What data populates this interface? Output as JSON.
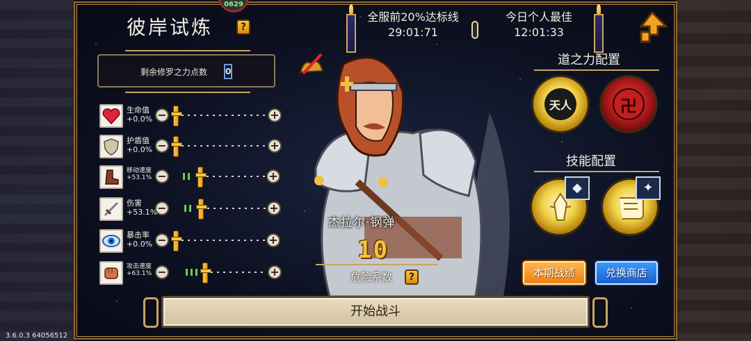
{
  "title": "彼岸试炼",
  "help_icon": "?",
  "top_gauge_label": "0629",
  "rank_threshold": {
    "label": "全服前20%达标线",
    "time": "29:01:71"
  },
  "personal_best": {
    "label": "今日个人最佳",
    "time": "12:01:33"
  },
  "points": {
    "label": "剩余修罗之力点数",
    "value": "0"
  },
  "stats": [
    {
      "name": "生命值",
      "value": "+0.0%",
      "icon": "heart-icon"
    },
    {
      "name": "护盾值",
      "value": "+0.0%",
      "icon": "shield-icon"
    },
    {
      "name": "移动速度",
      "value": "+53.1%",
      "icon": "boot-icon"
    },
    {
      "name": "伤害",
      "value": "+53.1%",
      "icon": "sword-icon"
    },
    {
      "name": "暴击率",
      "value": "+0.0%",
      "icon": "eye-icon"
    },
    {
      "name": "攻击速度",
      "value": "+63.1%",
      "icon": "fist-icon"
    }
  ],
  "hero": {
    "name": "杰拉尔·钢弹",
    "danger_level": "10",
    "danger_label": "危险系数"
  },
  "dao_section_title": "道之力配置",
  "dao_orbs": [
    {
      "glyph": "天人",
      "style": "gold"
    },
    {
      "glyph": "卍",
      "style": "red"
    }
  ],
  "skill_section_title": "技能配置",
  "skills": [
    {
      "icon": "rune-totem-icon",
      "badge": "◆"
    },
    {
      "icon": "scroll-icon",
      "badge": "✦"
    }
  ],
  "buttons": {
    "season_battle": "本期战绩",
    "exchange_shop": "兑换商店",
    "start_battle": "开始战斗"
  },
  "version": "3.6.0.3 64056512",
  "colors": {
    "gold": "#f6c23a",
    "orange": "#f07f16",
    "blue": "#1a5fd2",
    "frame": "#b08a4a"
  }
}
